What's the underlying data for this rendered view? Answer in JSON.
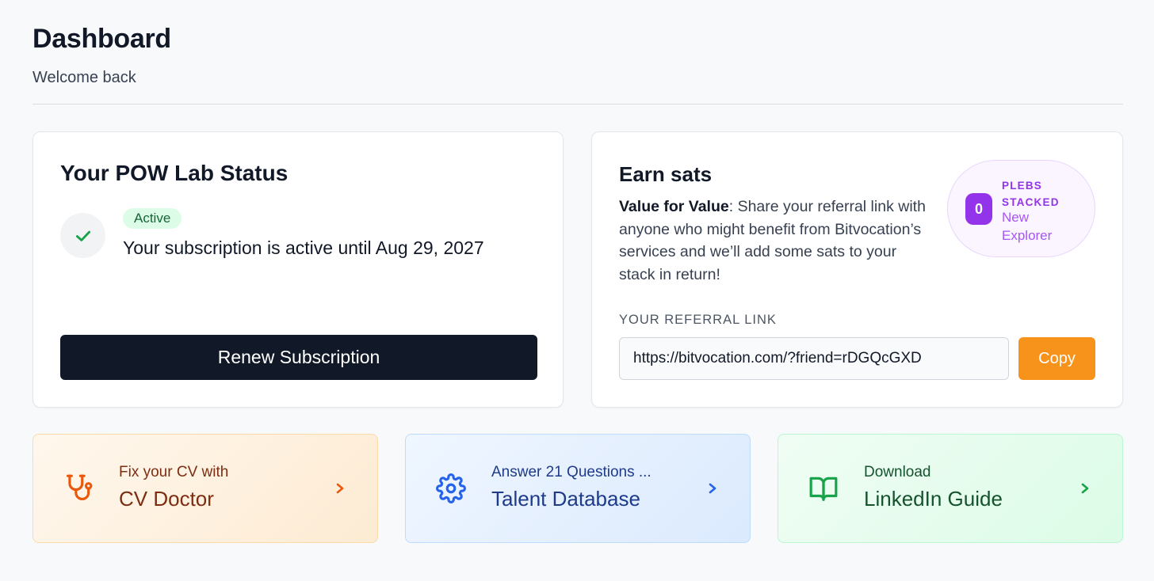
{
  "header": {
    "title": "Dashboard",
    "subtitle": "Welcome back"
  },
  "status_card": {
    "title": "Your POW Lab Status",
    "badge": "Active",
    "message": "Your subscription is active until Aug 29, 2027",
    "renew_label": "Renew Subscription",
    "icon": "check-icon"
  },
  "earn_card": {
    "title": "Earn sats",
    "desc_bold": "Value for Value",
    "desc_rest": ": Share your referral link with anyone who might benefit from Bitvocation’s services and we’ll add some sats to your stack in return!",
    "plebs_count": "0",
    "plebs_label": "PLEBS STACKED",
    "plebs_rank": "New Explorer",
    "ref_label": "YOUR REFERRAL LINK",
    "ref_value": "https://bitvocation.com/?friend=rDGQcGXD",
    "copy_label": "Copy"
  },
  "actions": [
    {
      "small": "Fix your CV with",
      "big": "CV Doctor",
      "icon": "stethoscope-icon",
      "accent": "#ea580c"
    },
    {
      "small": "Answer 21 Questions ...",
      "big": "Talent Database",
      "icon": "gear-icon",
      "accent": "#2563eb"
    },
    {
      "small": "Download",
      "big": "LinkedIn Guide",
      "icon": "book-icon",
      "accent": "#16a34a"
    }
  ],
  "colors": {
    "primary_dark": "#111827",
    "bitcoin_orange": "#f7931a",
    "active_green": "#16a34a",
    "purple": "#9333ea"
  }
}
